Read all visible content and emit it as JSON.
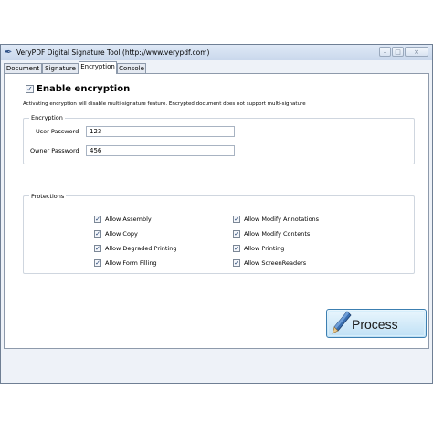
{
  "window": {
    "title": "VeryPDF Digital Signature Tool (http://www.verypdf.com)",
    "buttons": [
      "–",
      "□",
      "×"
    ]
  },
  "tabs": [
    {
      "label": "Document"
    },
    {
      "label": "Signature"
    },
    {
      "label": "Encryption",
      "active": true
    },
    {
      "label": "Console"
    }
  ],
  "encryption_page": {
    "enable_label": "Enable encryption",
    "enable_checked": true,
    "note": "Activating encryption will disable multi-signature feature. Encrypted document does not support multi-signature",
    "encryption_group": {
      "legend": "Encryption",
      "user_password_label": "User Password",
      "user_password_value": "123",
      "owner_password_label": "Owner Password",
      "owner_password_value": "456"
    },
    "protections_group": {
      "legend": "Protections",
      "left": [
        {
          "label": "Allow Assembly",
          "checked": true
        },
        {
          "label": "Allow Copy",
          "checked": true
        },
        {
          "label": "Allow Degraded Printing",
          "checked": true
        },
        {
          "label": "Allow Form Filling",
          "checked": true
        }
      ],
      "right": [
        {
          "label": "Allow Modify Annotations",
          "checked": true
        },
        {
          "label": "Allow Modify Contents",
          "checked": true
        },
        {
          "label": "Allow Printing",
          "checked": true
        },
        {
          "label": "Allow ScreenReaders",
          "checked": true
        }
      ]
    }
  },
  "process_button": {
    "label": "Process",
    "icon": "pencil-icon"
  },
  "colors": {
    "accent": "#3c7fb1",
    "window_bg": "#eef2f8",
    "titlebar": "#c9d8ec"
  }
}
